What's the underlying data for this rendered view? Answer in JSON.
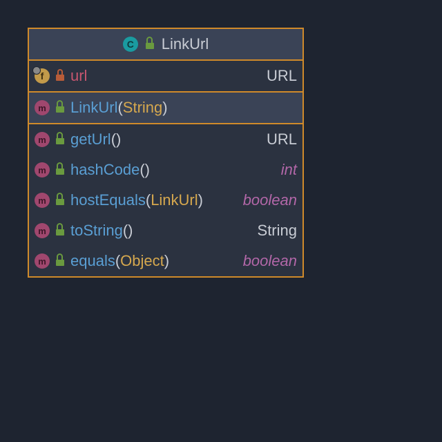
{
  "class": {
    "name": "LinkUrl",
    "icon": "C",
    "visibility": "public"
  },
  "fields": [
    {
      "icon": "f",
      "visibility": "private",
      "name": "url",
      "type": "URL",
      "primitive": false
    }
  ],
  "constructors": [
    {
      "icon": "m",
      "visibility": "public",
      "name": "LinkUrl",
      "params": "String",
      "highlight": true
    }
  ],
  "methods": [
    {
      "icon": "m",
      "visibility": "public",
      "name": "getUrl",
      "params": "",
      "return": "URL",
      "primitive": false
    },
    {
      "icon": "m",
      "visibility": "public",
      "name": "hashCode",
      "params": "",
      "return": "int",
      "primitive": true
    },
    {
      "icon": "m",
      "visibility": "public",
      "name": "hostEquals",
      "params": "LinkUrl",
      "return": "boolean",
      "primitive": true
    },
    {
      "icon": "m",
      "visibility": "public",
      "name": "toString",
      "params": "",
      "return": "String",
      "primitive": false
    },
    {
      "icon": "m",
      "visibility": "public",
      "name": "equals",
      "params": "Object",
      "return": "boolean",
      "primitive": true
    }
  ]
}
